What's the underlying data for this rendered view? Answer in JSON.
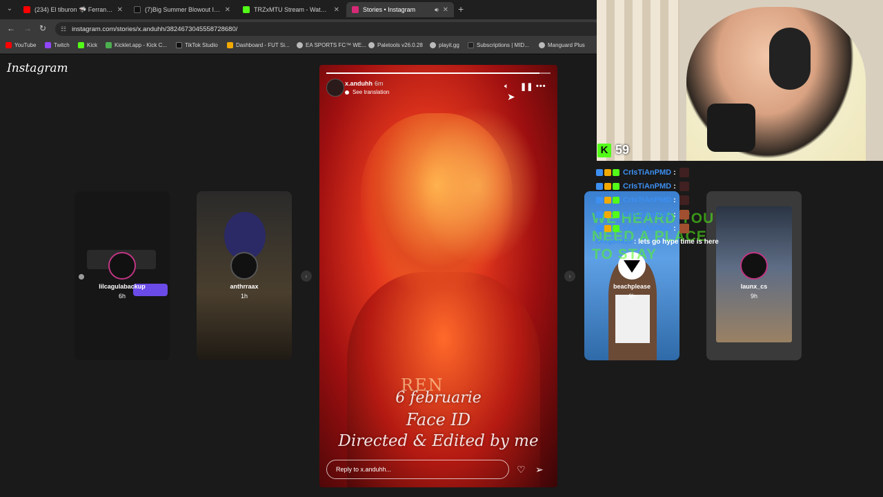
{
  "browser": {
    "tabs": [
      {
        "title": "(234) El tiburon 🦈 Ferran torres",
        "color": "#ff0000"
      },
      {
        "title": "(7)Big Summer Blowout Impressions",
        "color": "#111111"
      },
      {
        "title": "TRZxMTU Stream - Watch Live",
        "color": "#53fc18"
      },
      {
        "title": "Stories • Instagram",
        "color": "#d62976"
      }
    ],
    "url": "instagram.com/stories/x.anduhh/3824673045558728680/",
    "bookmarks": [
      {
        "label": "YouTube",
        "color": "#ff0000"
      },
      {
        "label": "Twitch",
        "color": "#9146ff"
      },
      {
        "label": "Kick",
        "color": "#53fc18"
      },
      {
        "label": "Kicklet.app - Kick C...",
        "color": "#4caf50"
      },
      {
        "label": "TikTok Studio",
        "color": "#111111"
      },
      {
        "label": "Dashboard - FUT Si...",
        "color": "#f2a900"
      },
      {
        "label": "EA SPORTS FC™ WE...",
        "color": "#bbbbbb"
      },
      {
        "label": "Paletools v26.0.28",
        "color": "#bbbbbb"
      },
      {
        "label": "playit.gg",
        "color": "#bbbbbb"
      },
      {
        "label": "Subscriptions | MID...",
        "color": "#222222"
      },
      {
        "label": "Manguard Plus",
        "color": "#bbbbbb"
      }
    ]
  },
  "instagram": {
    "logo": "Instagram",
    "left_stories": [
      {
        "username": "lilcagulabackup",
        "time": "6h"
      },
      {
        "username": "anthrraax",
        "time": "1h"
      }
    ],
    "right_stories": [
      {
        "username": "beachplease",
        "time": "6h"
      },
      {
        "username": "launx_cs",
        "time": "9h"
      }
    ],
    "current_story": {
      "username": "x.anduhh",
      "time": "6m",
      "translate_label": "See translation",
      "progress": 0.95,
      "caption": [
        "6 februarie",
        "Face ID",
        "Directed & Edited by me"
      ],
      "reply_placeholder": "Reply to x.anduhh...",
      "jersey_text": "REN"
    }
  },
  "stream_overlay": {
    "viewer_count": "59",
    "kick_logo": "K",
    "chat": [
      {
        "name": "CrIsTiAnPMD"
      },
      {
        "name": "CrIsTiAnPMD"
      },
      {
        "name": "CrIsTiAnPMD"
      },
      {
        "name": "CrIsTiAnPMD"
      },
      {
        "name": "CrIsTiAnPMD"
      }
    ],
    "message": {
      "name": "Oregon420",
      "text": "lets go hype time is here"
    },
    "ad_text": [
      "WE HEARD YOU",
      "NEED A PLACE",
      "TO STAY"
    ]
  }
}
